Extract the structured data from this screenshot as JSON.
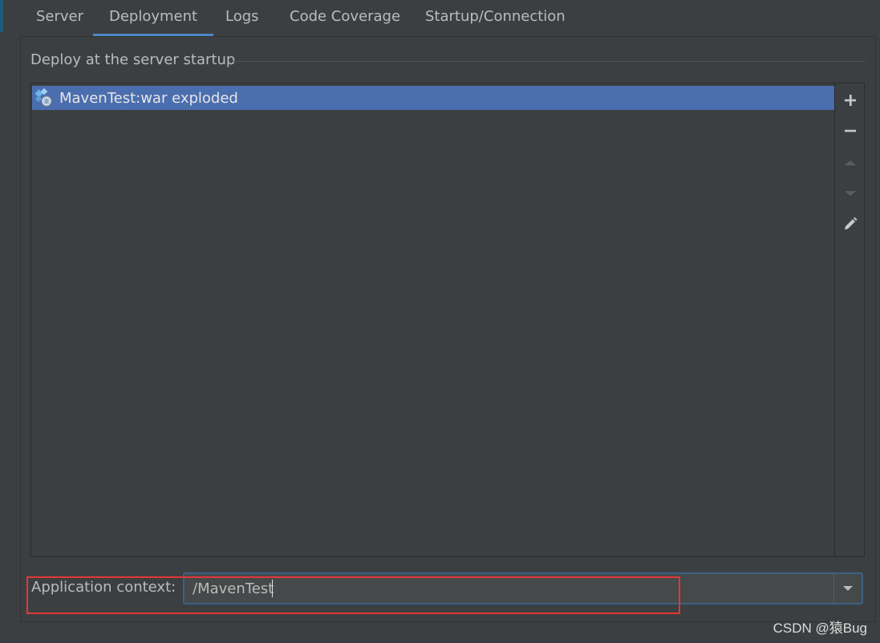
{
  "tabs": [
    {
      "label": "Server",
      "active": false
    },
    {
      "label": "Deployment",
      "active": true
    },
    {
      "label": "Logs",
      "active": false
    },
    {
      "label": "Code Coverage",
      "active": false
    },
    {
      "label": "Startup/Connection",
      "active": false
    }
  ],
  "deploy_section": {
    "title": "Deploy at the server startup",
    "artifacts": [
      {
        "label": "MavenTest:war exploded",
        "icon": "war-exploded-icon",
        "selected": true
      }
    ],
    "toolbar": [
      {
        "name": "add-icon",
        "enabled": true
      },
      {
        "name": "remove-icon",
        "enabled": true
      },
      {
        "name": "move-up-icon",
        "enabled": false
      },
      {
        "name": "move-down-icon",
        "enabled": false
      },
      {
        "name": "edit-icon",
        "enabled": true
      }
    ]
  },
  "application_context": {
    "label": "Application context:",
    "value": "/MavenTest"
  },
  "watermark": "CSDN @猿Bug",
  "colors": {
    "background": "#3c3f41",
    "selection": "#4b6eaf",
    "active_tab_underline": "#4a88c7",
    "focus_border": "#3d6185",
    "highlight_annotation": "#e13838"
  }
}
